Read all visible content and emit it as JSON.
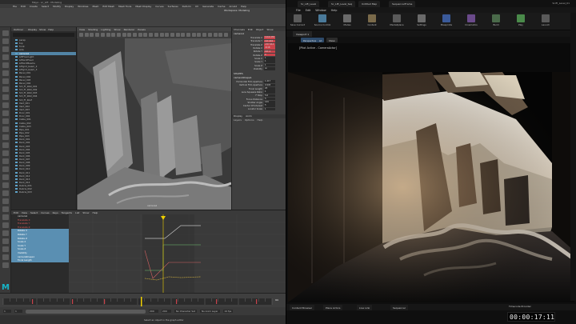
{
  "maya": {
    "title": "Maya - sc_Lift - Modeling",
    "menus": [
      "File",
      "Edit",
      "Create",
      "Select",
      "Modify",
      "Display",
      "Windows",
      "Mesh",
      "Edit Mesh",
      "Mesh Tools",
      "Mesh Display",
      "Curves",
      "Surfaces",
      "Deform",
      "UV",
      "Generate",
      "Cache",
      "Arnold",
      "Help"
    ],
    "workspace": "Workspace: Modeling",
    "outliner": {
      "header": "Outliner",
      "menus": [
        "Display",
        "Show",
        "Help"
      ],
      "items": [
        "persp",
        "top",
        "front",
        "side",
        "camera1",
        "LiftFloorLight",
        "LiftGridFixed",
        "LiftGridBeams",
        "Liftgrid_beam_2",
        "Liftgrid_beam_3",
        "Panel_001",
        "Panel_002",
        "Panel_003",
        "Panel_004",
        "SCI_FI_Wall_001",
        "SCI_FI_Wall_002",
        "SCI_FI_Wall_003",
        "SCI_FI_Wall_004",
        "SCI_FI_Roof",
        "Vent_001",
        "Vent_002",
        "Vent_003",
        "Door_001",
        "Door_002",
        "Cable_001",
        "Cable_002",
        "Cable_003",
        "Pipe_001",
        "Pipe_002",
        "Pipe_003",
        "Rock_001",
        "Rock_002",
        "Rock_003",
        "Rock_004",
        "Rock_005",
        "Rock_006",
        "Rock_007",
        "Rock_008",
        "Rock_009",
        "Rock_010",
        "Rock_011",
        "Rock_012",
        "Rock_013",
        "Rock_014",
        "Debris_001",
        "Debris_002",
        "Debris_003"
      ]
    },
    "viewport": {
      "menus": [
        "View",
        "Shading",
        "Lighting",
        "Show",
        "Renderer",
        "Panels"
      ],
      "camera_label": "camera1"
    },
    "channel_box": {
      "tabs": [
        "Channels",
        "Edit",
        "Object",
        "Show"
      ],
      "object": "camera1",
      "transform": [
        {
          "k": "Translate X",
          "v": "1114.476"
        },
        {
          "k": "Translate Y",
          "v": "121.001"
        },
        {
          "k": "Translate Z",
          "v": "-157.414"
        },
        {
          "k": "Rotate X",
          "v": "-8.18"
        },
        {
          "k": "Rotate Y",
          "v": "101.2"
        },
        {
          "k": "Rotate Z",
          "v": "0"
        },
        {
          "k": "Scale X",
          "v": "1"
        },
        {
          "k": "Scale Y",
          "v": "1"
        },
        {
          "k": "Scale Z",
          "v": "1"
        },
        {
          "k": "Visibility",
          "v": "on"
        }
      ],
      "shapes_header": "SHAPES",
      "shape_name": "cameraShape1",
      "shape_attrs": [
        {
          "k": "Horizontal Film Aperture",
          "v": "1.417"
        },
        {
          "k": "Vertical Film Aperture",
          "v": "0.945"
        },
        {
          "k": "Focal Length",
          "v": "25"
        },
        {
          "k": "Lens Squeeze Ratio",
          "v": "1"
        },
        {
          "k": "F Stop",
          "v": "5.6"
        },
        {
          "k": "Focus Distance",
          "v": "5"
        },
        {
          "k": "Shutter Angle",
          "v": "144"
        },
        {
          "k": "Center Of Interest",
          "v": "5"
        },
        {
          "k": "Locator Scale",
          "v": "1"
        }
      ],
      "layer_tabs": [
        "Display",
        "Anim"
      ],
      "layer_menus": [
        "Layers",
        "Options",
        "Help"
      ]
    },
    "graph_editor": {
      "menus": [
        "Edit",
        "View",
        "Select",
        "Curves",
        "Keys",
        "Tangents",
        "List",
        "Show",
        "Help"
      ],
      "curves": [
        "camera1",
        "Translate X",
        "Translate Y",
        "Translate Z",
        "Rotate X",
        "Rotate Y",
        "Rotate Z",
        "Scale X",
        "Scale Y",
        "Scale Z",
        "Visibility",
        "cameraShape1",
        "Focal Length"
      ]
    },
    "timeline": {
      "start": "1",
      "end": "200",
      "current": "94"
    },
    "range": {
      "start": "1",
      "end": "200",
      "anim_start": "1",
      "anim_end": "200",
      "fps": "24 fps",
      "no_char_set": "No Character Set",
      "no_anim_layer": "No Anim Layer"
    },
    "status": "Select an object in the graph editor",
    "logo": "M"
  },
  "unreal": {
    "tabs": [
      "Sc_Lift_Level",
      "Sc_Lift_Level_Seq",
      "Untitled Map",
      "SequencerFrame"
    ],
    "window_label": "SciFi_Level_01",
    "menus": [
      "File",
      "Edit",
      "Window",
      "Help"
    ],
    "toolbar": [
      {
        "label": "Save Current",
        "color": "#5a5a5a"
      },
      {
        "label": "Source Control",
        "color": "#4a7a9a"
      },
      {
        "label": "Modes",
        "color": "#6a6a6a"
      },
      {
        "label": "Content",
        "color": "#7a6a4a"
      },
      {
        "label": "Marketplace",
        "color": "#5a5a5a"
      },
      {
        "label": "Settings",
        "color": "#6a6a6a"
      },
      {
        "label": "Blueprints",
        "color": "#3a5a9a"
      },
      {
        "label": "Cinematics",
        "color": "#6a4a8a"
      },
      {
        "label": "Build",
        "color": "#4a6a4a"
      },
      {
        "label": "Play",
        "color": "#4a8a4a"
      },
      {
        "label": "Launch",
        "color": "#5a5a5a"
      }
    ],
    "viewport_tab": "Viewport 1",
    "vp_controls": [
      "Perspective",
      "Lit",
      "Show"
    ],
    "vp_label": "[Pilot Active - CameraActor]",
    "bottom_tabs": [
      "Content Browser",
      "Place Actors",
      "Live Link",
      "Sequencer"
    ],
    "sequencer_tab": "Timecode Provider",
    "timecode": "00:00:17:11"
  },
  "colors": {
    "maya_bg": "#444444",
    "unreal_bg": "#0f0f0f",
    "selection": "#5285a6",
    "keyframe_red": "#c9434b",
    "playhead": "#f0d000",
    "maya_logo": "#16b4c7"
  }
}
